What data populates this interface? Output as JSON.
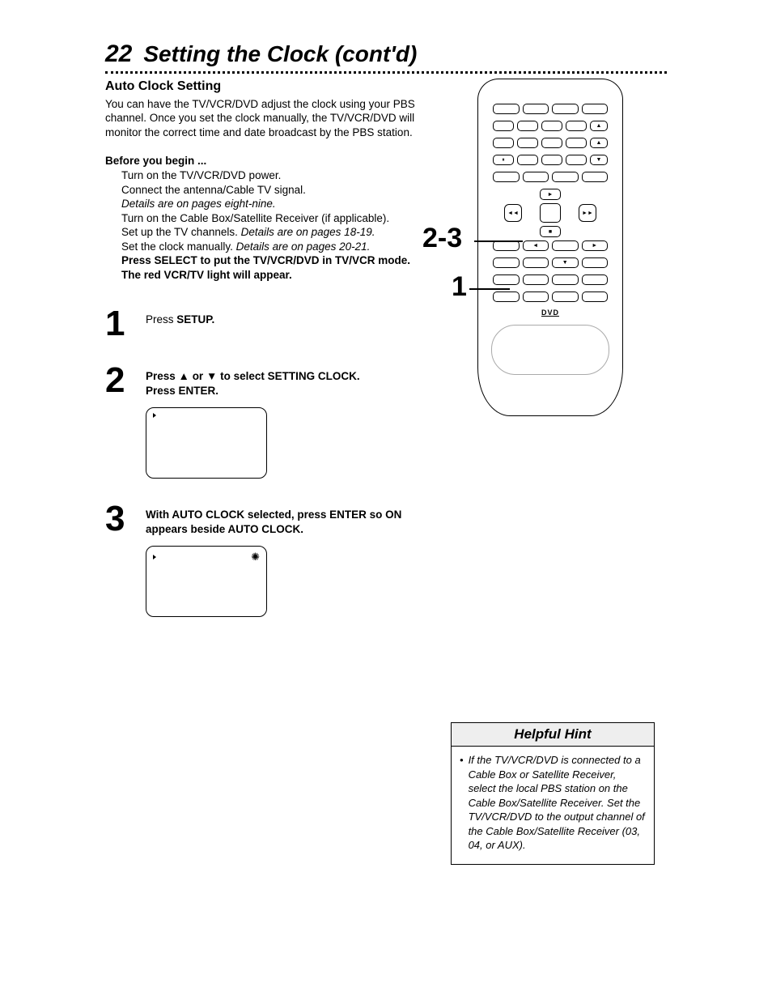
{
  "page": {
    "number": "22",
    "title": "Setting the Clock (cont'd)"
  },
  "section": {
    "heading": "Auto Clock Setting",
    "intro": "You can have the TV/VCR/DVD adjust the clock using your PBS channel. Once you set the clock manually, the TV/VCR/DVD will monitor the correct time and date broadcast by the PBS station.",
    "before_heading": "Before you begin ...",
    "before": {
      "l1": "Turn on the TV/VCR/DVD power.",
      "l2": "Connect the antenna/Cable TV signal.",
      "l3_ital": "Details are on pages eight-nine.",
      "l4a": "Turn on the Cable Box/Satellite Receiver (if applicable).",
      "l5a": "Set up the TV channels. ",
      "l5b_ital": "Details are on pages 18-19.",
      "l6a": "Set the clock manually. ",
      "l6b_ital": "Details are on pages 20-21.",
      "l7_bold": "Press SELECT to put the TV/VCR/DVD in TV/VCR mode. The red VCR/TV light will appear."
    }
  },
  "steps": {
    "s1": {
      "num": "1",
      "text_a": "Press ",
      "text_b_bold": "SETUP."
    },
    "s2": {
      "num": "2",
      "line1_a": "Press ",
      "line1_mid": " or ",
      "line1_c": " to select ",
      "line1_d_bold": "SETTING CLOCK.",
      "line2_a": "Press ",
      "line2_b_bold": "ENTER."
    },
    "s3": {
      "num": "3",
      "text_bold": "With AUTO CLOCK selected, press ENTER so ON appears beside AUTO CLOCK."
    }
  },
  "callouts": {
    "top": "2-3",
    "bottom": "1"
  },
  "remote": {
    "dvd": "DVD"
  },
  "hint": {
    "title": "Helpful Hint",
    "body": "If the TV/VCR/DVD is connected to a Cable Box or Satellite Receiver, select the local PBS station on the Cable Box/Satellite Receiver. Set the TV/VCR/DVD to the output channel of the Cable Box/Satellite Receiver (03, 04, or AUX)."
  }
}
